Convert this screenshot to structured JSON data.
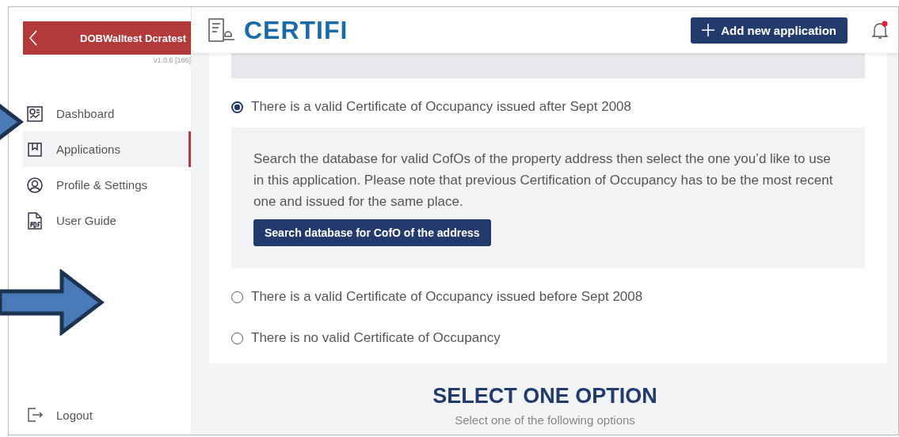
{
  "sidebar": {
    "user_name": "DOBWalltest Dcratest",
    "version": "v1.0.6 [186]",
    "items": [
      {
        "kind": "dashboard",
        "label": "Dashboard",
        "selected": false
      },
      {
        "kind": "applications",
        "label": "Applications",
        "selected": true
      },
      {
        "kind": "profile",
        "label": "Profile & Settings",
        "selected": false
      },
      {
        "kind": "guide",
        "label": "User Guide",
        "selected": false
      }
    ],
    "logout": "Logout"
  },
  "header": {
    "logo": "CERTIFI",
    "add_button": "Add new application",
    "notification": true
  },
  "options": [
    {
      "label": "There is a valid Certificate of Occupancy issued after Sept 2008",
      "selected": true,
      "description": "Search the database for valid CofOs of the property address then select the one you’d like to use in this application. Please note that previous Certification of Occupancy has to be the most recent one and issued for the same place.",
      "button": "Search database for CofO of the address"
    },
    {
      "label": "There is a valid Certificate of Occupancy issued before Sept 2008",
      "selected": false
    },
    {
      "label": "There is no valid Certificate of Occupancy",
      "selected": false
    }
  ],
  "section": {
    "heading": "SELECT ONE OPTION",
    "subtitle": "Select one of the following options"
  },
  "annotations": [
    {
      "kind": "arrow"
    },
    {
      "kind": "arrow"
    }
  ]
}
